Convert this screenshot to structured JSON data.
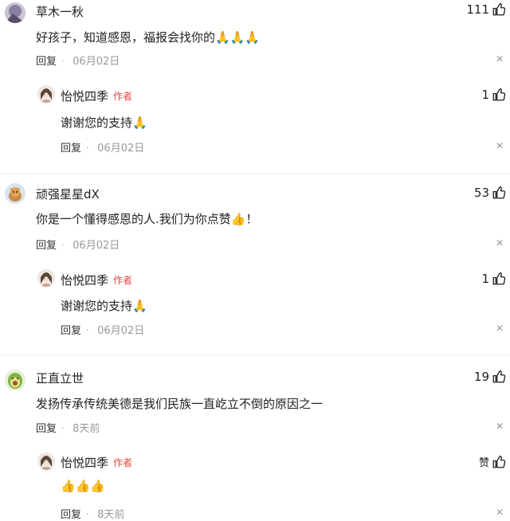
{
  "comments": [
    {
      "user": "草木一秋",
      "text": "好孩子，知道感恩，福报会找你的🙏🙏🙏",
      "likes": "111",
      "reply_label": "回复",
      "date": "06月02日",
      "reply": {
        "user": "怡悦四季",
        "tag": "作者",
        "text": "谢谢您的支持🙏",
        "likes": "1",
        "reply_label": "回复",
        "date": "06月02日"
      }
    },
    {
      "user": "顽强星星dX",
      "text": "你是一个懂得感恩的人.我们为你点赞👍！",
      "likes": "53",
      "reply_label": "回复",
      "date": "06月02日",
      "reply": {
        "user": "怡悦四季",
        "tag": "作者",
        "text": "谢谢您的支持🙏",
        "likes": "1",
        "reply_label": "回复",
        "date": "06月02日"
      }
    },
    {
      "user": "正直立世",
      "text": "发扬传承传统美德是我们民族一直屹立不倒的原因之一",
      "likes": "19",
      "reply_label": "回复",
      "date": "8天前",
      "reply": {
        "user": "怡悦四季",
        "tag": "作者",
        "text": "👍👍👍",
        "likes": "赞",
        "reply_label": "回复",
        "date": "8天前"
      }
    }
  ],
  "icons": {
    "like": "thumbs-up-icon",
    "close": "close-icon"
  },
  "colors": {
    "author_tag": "#e8443a",
    "date": "#999999"
  }
}
